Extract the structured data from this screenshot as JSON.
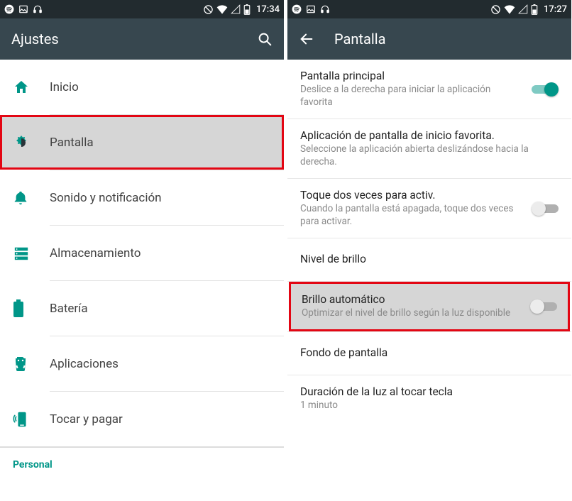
{
  "left": {
    "status": {
      "time": "17:34"
    },
    "appbar": {
      "title": "Ajustes"
    },
    "items": [
      {
        "label": "Inicio"
      },
      {
        "label": "Pantalla"
      },
      {
        "label": "Sonido y notificación"
      },
      {
        "label": "Almacenamiento"
      },
      {
        "label": "Batería"
      },
      {
        "label": "Aplicaciones"
      },
      {
        "label": "Tocar y pagar"
      }
    ],
    "section": "Personal"
  },
  "right": {
    "status": {
      "time": "17:27"
    },
    "appbar": {
      "title": "Pantalla"
    },
    "settings": [
      {
        "title": "Pantalla principal",
        "sub": "Deslice a la derecha para iniciar la aplicación favorita",
        "switch": "on"
      },
      {
        "title": "Aplicación de pantalla de inicio favorita.",
        "sub": "Seleccione la aplicación abierta deslizándose hacia la derecha."
      },
      {
        "title": "Toque dos veces para activ.",
        "sub": "Cuando la pantalla está apagada, toque dos veces para activar.",
        "switch": "off"
      },
      {
        "title": "Nivel de brillo"
      },
      {
        "title": "Brillo automático",
        "sub": "Optimizar el nivel de brillo según la luz disponible",
        "switch": "off"
      },
      {
        "title": "Fondo de pantalla"
      },
      {
        "title": "Duración de la luz al tocar tecla",
        "sub": "1 minuto"
      }
    ]
  }
}
